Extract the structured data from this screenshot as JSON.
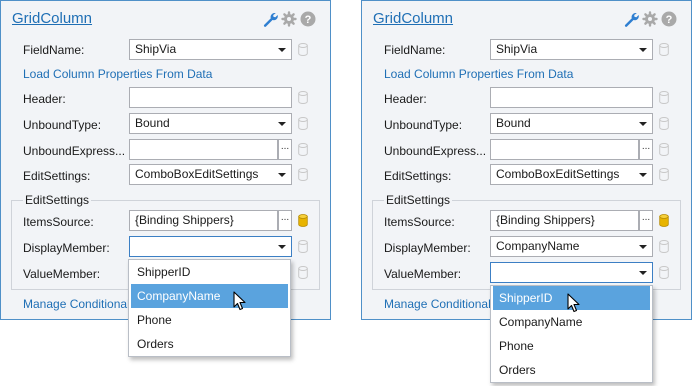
{
  "panels": [
    {
      "title": "GridColumn",
      "header_icons": [
        "wrench-icon",
        "gear-icon",
        "help-icon"
      ],
      "rows": {
        "field_name": {
          "label": "FieldName:",
          "value": "ShipVia"
        },
        "load_link": "Load Column Properties From Data",
        "header": {
          "label": "Header:",
          "value": ""
        },
        "unbound_type": {
          "label": "UnboundType:",
          "value": "Bound"
        },
        "unbound_expression": {
          "label": "UnboundExpress...",
          "value": "",
          "button": "..."
        },
        "edit_settings": {
          "label": "EditSettings:",
          "value": "ComboBoxEditSettings"
        }
      },
      "group_title": "EditSettings",
      "group_rows": {
        "items_source": {
          "label": "ItemsSource:",
          "value": "{Binding Shippers}",
          "button": "..."
        },
        "display_member": {
          "label": "DisplayMember:",
          "value": ""
        },
        "value_member": {
          "label": "ValueMember:",
          "value": ""
        }
      },
      "footer_link": "Manage Conditional",
      "open_dropdown": "display_member",
      "dropdown_items": [
        "ShipperID",
        "CompanyName",
        "Phone",
        "Orders"
      ],
      "dropdown_selected": "CompanyName"
    },
    {
      "title": "GridColumn",
      "header_icons": [
        "wrench-icon",
        "gear-icon",
        "help-icon"
      ],
      "rows": {
        "field_name": {
          "label": "FieldName:",
          "value": "ShipVia"
        },
        "load_link": "Load Column Properties From Data",
        "header": {
          "label": "Header:",
          "value": ""
        },
        "unbound_type": {
          "label": "UnboundType:",
          "value": "Bound"
        },
        "unbound_expression": {
          "label": "UnboundExpress...",
          "value": "",
          "button": "..."
        },
        "edit_settings": {
          "label": "EditSettings:",
          "value": "ComboBoxEditSettings"
        }
      },
      "group_title": "EditSettings",
      "group_rows": {
        "items_source": {
          "label": "ItemsSource:",
          "value": "{Binding Shippers}",
          "button": "..."
        },
        "display_member": {
          "label": "DisplayMember:",
          "value": "CompanyName"
        },
        "value_member": {
          "label": "ValueMember:",
          "value": ""
        }
      },
      "footer_link": "Manage Conditional",
      "open_dropdown": "value_member",
      "dropdown_items": [
        "ShipperID",
        "CompanyName",
        "Phone",
        "Orders"
      ],
      "dropdown_selected": "ShipperID"
    }
  ],
  "colors": {
    "accent": "#1f6fb5",
    "panel_border": "#4f90c8",
    "selection": "#5aa3de",
    "bound_database": "#e8b400",
    "unbound_database": "#c8c8c8"
  }
}
